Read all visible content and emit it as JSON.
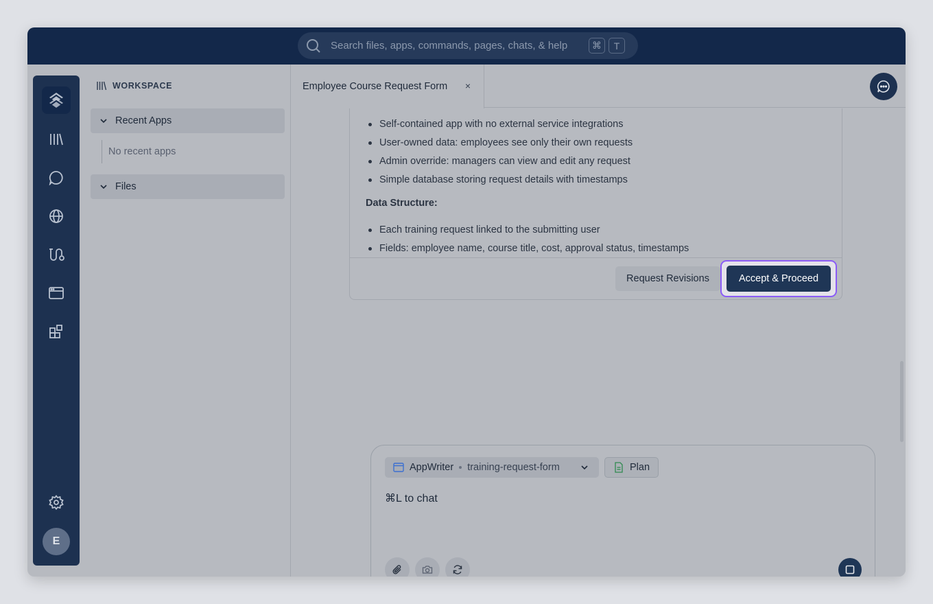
{
  "search": {
    "placeholder": "Search files, apps, commands, pages, chats, & help",
    "shortcut_keys": [
      "⌘",
      "T"
    ]
  },
  "rail": {
    "icons": [
      "logo-icon",
      "library-icon",
      "chat-bubble-icon",
      "globe-icon",
      "route-icon",
      "browser-window-icon",
      "widgets-icon",
      "settings-icon"
    ],
    "avatar_initial": "E"
  },
  "sidebar": {
    "workspace_label": "WORKSPACE",
    "sections": [
      {
        "label": "Recent Apps",
        "empty_text": "No recent apps"
      },
      {
        "label": "Files"
      }
    ]
  },
  "tabs": [
    {
      "label": "Employee Course Request Form",
      "close": "×"
    }
  ],
  "plan": {
    "items_top": [
      "Self-contained app with no external service integrations",
      "User-owned data: employees see only their own requests",
      "Admin override: managers can view and edit any request",
      "Simple database storing request details with timestamps"
    ],
    "data_heading": "Data Structure:",
    "items_data": [
      "Each training request linked to the submitting user",
      "Fields: employee name, course title, cost, approval status, timestamps"
    ],
    "revise_label": "Request Revisions",
    "accept_label": "Accept & Proceed"
  },
  "composer": {
    "app_name": "AppWriter",
    "app_slug": "training-request-form",
    "plan_label": "Plan",
    "hint": "⌘L to chat",
    "tools": [
      "paperclip-icon",
      "camera-icon",
      "refresh-icon"
    ]
  },
  "colors": {
    "topbar": "#13284a",
    "rail": "#1d3150",
    "accent_primary": "#1f3656",
    "focus_ring": "#8b5cf6"
  }
}
